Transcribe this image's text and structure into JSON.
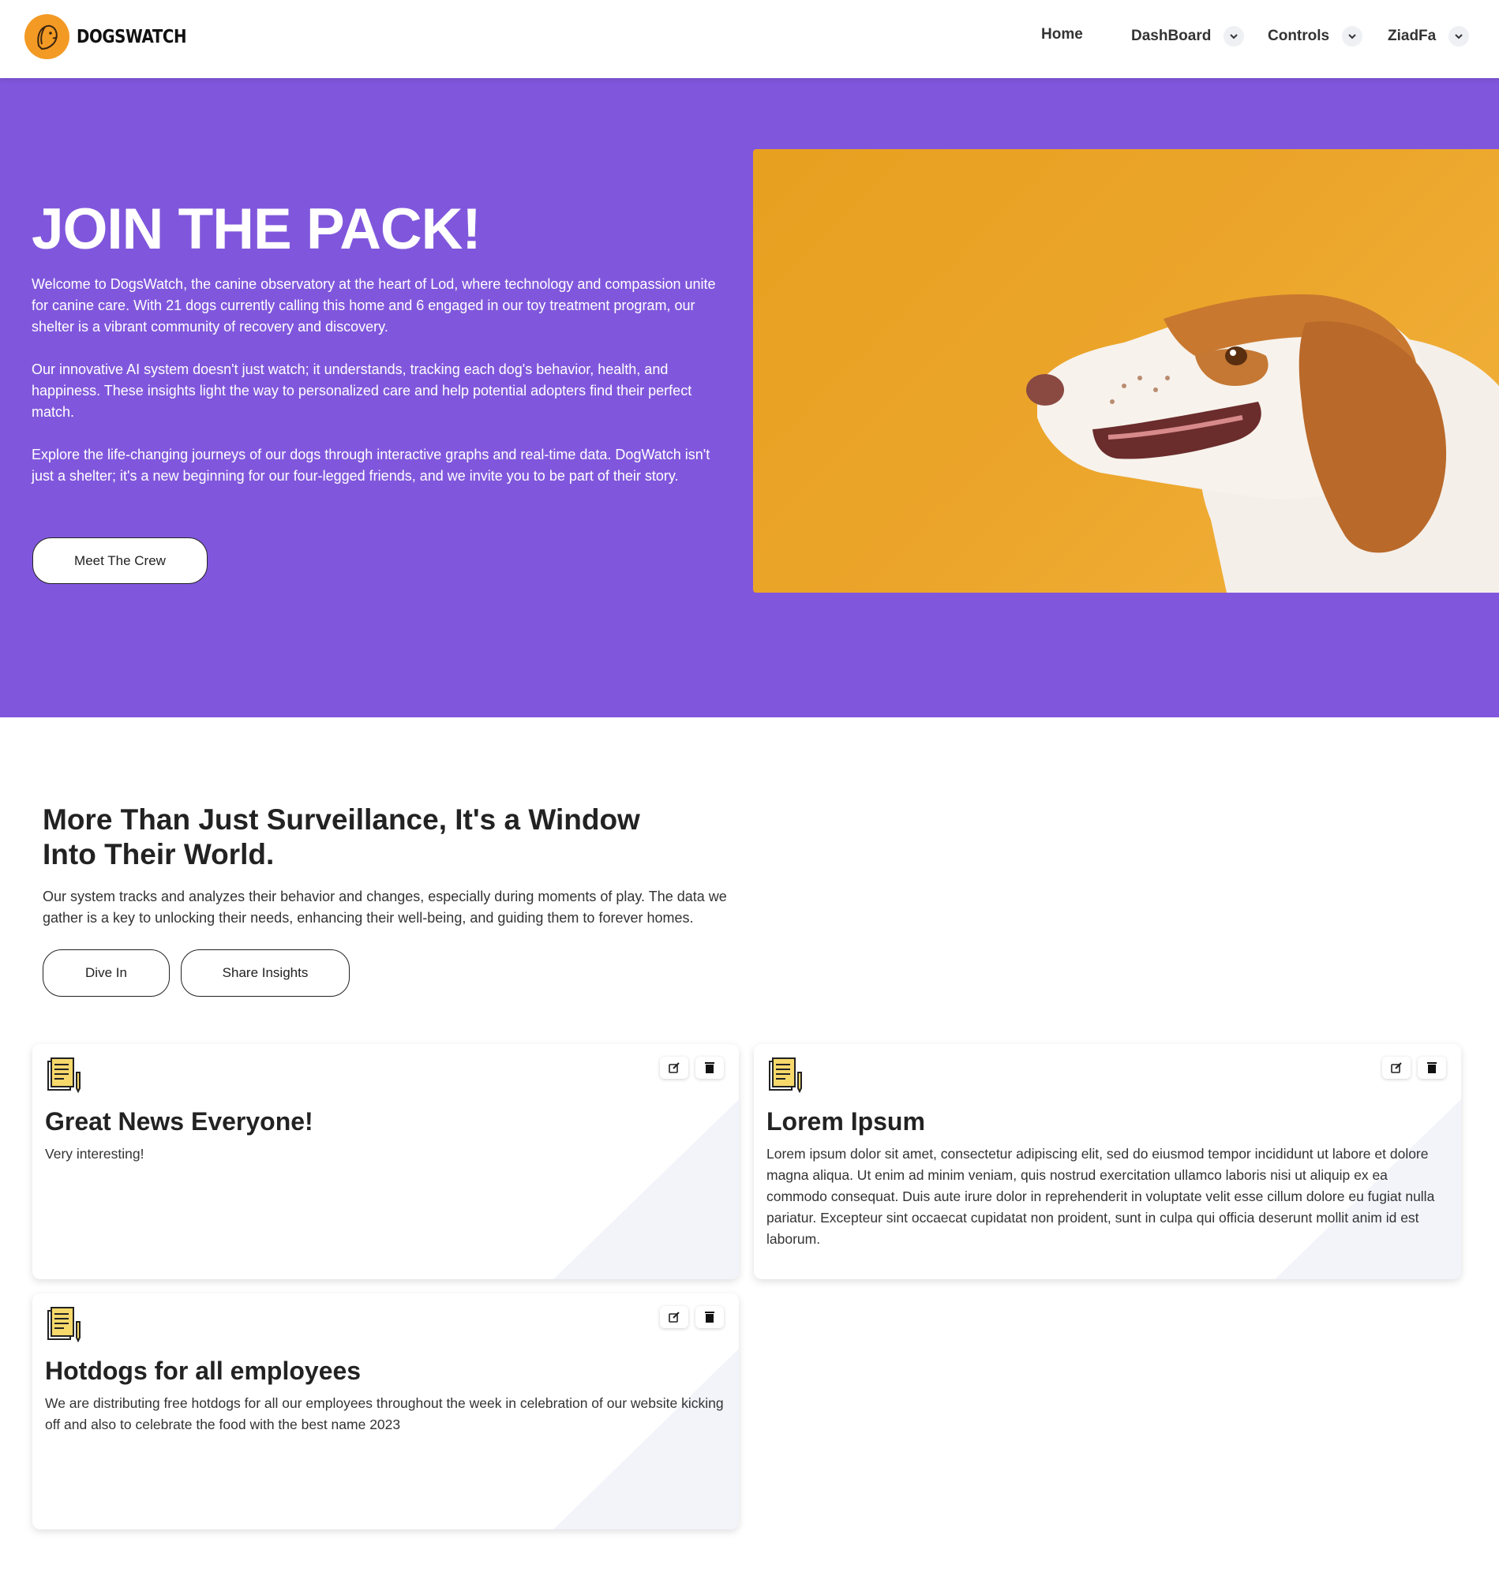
{
  "navbar": {
    "brand": "DOGSWATCH",
    "items": [
      {
        "label": "Home"
      },
      {
        "label": "DashBoard"
      },
      {
        "label": "Controls"
      },
      {
        "label": "ZiadFa"
      }
    ]
  },
  "hero": {
    "title": "JOIN THE PACK!",
    "paragraphs": [
      "Welcome to DogsWatch, the canine observatory at the heart of Lod, where technology and compassion unite for canine care. With 21 dogs currently calling this home and 6 engaged in our toy treatment program, our shelter is a vibrant community of recovery and discovery.",
      "Our innovative AI system doesn't just watch; it understands, tracking each dog's behavior, health, and happiness. These insights light the way to personalized care and help potential adopters find their perfect match.",
      "Explore the life-changing journeys of our dogs through interactive graphs and real-time data. DogWatch isn't just a shelter; it's a new beginning for our four-legged friends, and we invite you to be part of their story."
    ],
    "button": "Meet The Crew",
    "image": "beagle-dog-photo"
  },
  "section": {
    "title": "More Than Just Surveillance, It's a Window Into Their World.",
    "text": "Our system tracks and analyzes their behavior and changes, especially during moments of play. The data we gather is a key to unlocking their needs, enhancing their well-being, and guiding them to forever homes.",
    "buttons": [
      "Dive In",
      "Share Insights"
    ]
  },
  "cards": [
    {
      "title": "Great News Everyone!",
      "text": "Very interesting!"
    },
    {
      "title": "Lorem Ipsum",
      "text": "Lorem ipsum dolor sit amet, consectetur adipiscing elit, sed do eiusmod tempor incididunt ut labore et dolore magna aliqua. Ut enim ad minim veniam, quis nostrud exercitation ullamco laboris nisi ut aliquip ex ea commodo consequat. Duis aute irure dolor in reprehenderit in voluptate velit esse cillum dolore eu fugiat nulla pariatur. Excepteur sint occaecat cupidatat non proident, sunt in culpa qui officia deserunt mollit anim id est laborum."
    },
    {
      "title": "Hotdogs for all employees",
      "text": "We are distributing free hotdogs for all our employees throughout the week in celebration of our website kicking off and also to celebrate the food with the best name 2023"
    }
  ],
  "colors": {
    "hero_bg": "#8057dc",
    "logo": "#f39a24",
    "image_bg": "#eba52a"
  },
  "icons": [
    "logo-dog-icon",
    "chevron-down-icon",
    "document-pen-icon",
    "edit-icon",
    "trash-icon"
  ]
}
